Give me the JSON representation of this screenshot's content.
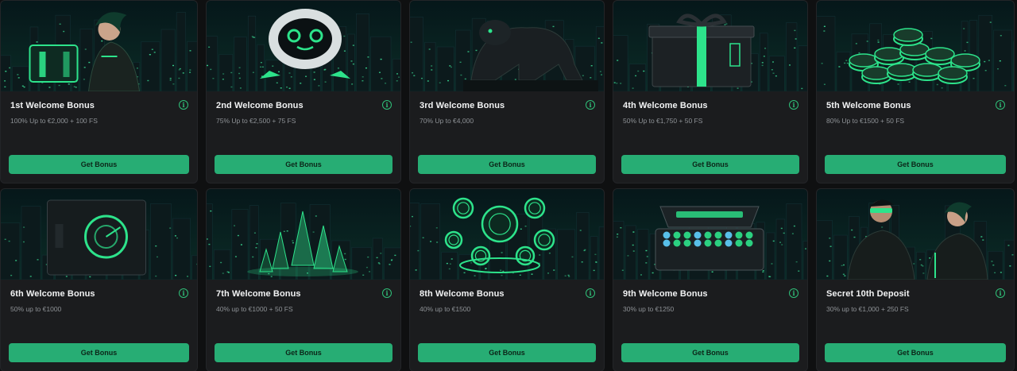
{
  "colors": {
    "page_background": "#0f1011",
    "card_background": "#1b1c1e",
    "accent": "#27ad74",
    "neon": "#2de38b",
    "title_text": "#f2f3f4",
    "desc_text": "#8e9296"
  },
  "cards": [
    {
      "title": "1st Welcome Bonus",
      "desc": "100% Up to €2,000 + 100 FS",
      "button": "Get Bonus",
      "info_icon": "info-icon",
      "art": "cyber-woman-holding-cube"
    },
    {
      "title": "2nd Welcome Bonus",
      "desc": "75% Up to €2,500 + 75 FS",
      "button": "Get Bonus",
      "info_icon": "info-icon",
      "art": "robot-helmet"
    },
    {
      "title": "3rd Welcome Bonus",
      "desc": "70% Up to €4,000",
      "button": "Get Bonus",
      "info_icon": "info-icon",
      "art": "cyber-panther"
    },
    {
      "title": "4th Welcome Bonus",
      "desc": "50% Up to €1,750 + 50 FS",
      "button": "Get Bonus",
      "info_icon": "info-icon",
      "art": "gift-box"
    },
    {
      "title": "5th Welcome Bonus",
      "desc": "80% Up to €1500 + 50 FS",
      "button": "Get Bonus",
      "info_icon": "info-icon",
      "art": "casino-chips"
    },
    {
      "title": "6th Welcome Bonus",
      "desc": "50% up to €1000",
      "button": "Get Bonus",
      "info_icon": "info-icon",
      "art": "vault-safe"
    },
    {
      "title": "7th Welcome Bonus",
      "desc": "40% up to €1000 + 50 FS",
      "button": "Get Bonus",
      "info_icon": "info-icon",
      "art": "green-crystals"
    },
    {
      "title": "8th Welcome Bonus",
      "desc": "40% up to €1500",
      "button": "Get Bonus",
      "info_icon": "info-icon",
      "art": "floating-coins"
    },
    {
      "title": "9th Welcome Bonus",
      "desc": "30% up to €1250",
      "button": "Get Bonus",
      "info_icon": "info-icon",
      "art": "treasure-chest"
    },
    {
      "title": "Secret 10th Deposit",
      "desc": "30% up to €1,000 + 250 FS",
      "button": "Get Bonus",
      "info_icon": "info-icon",
      "art": "cyber-duo"
    }
  ]
}
